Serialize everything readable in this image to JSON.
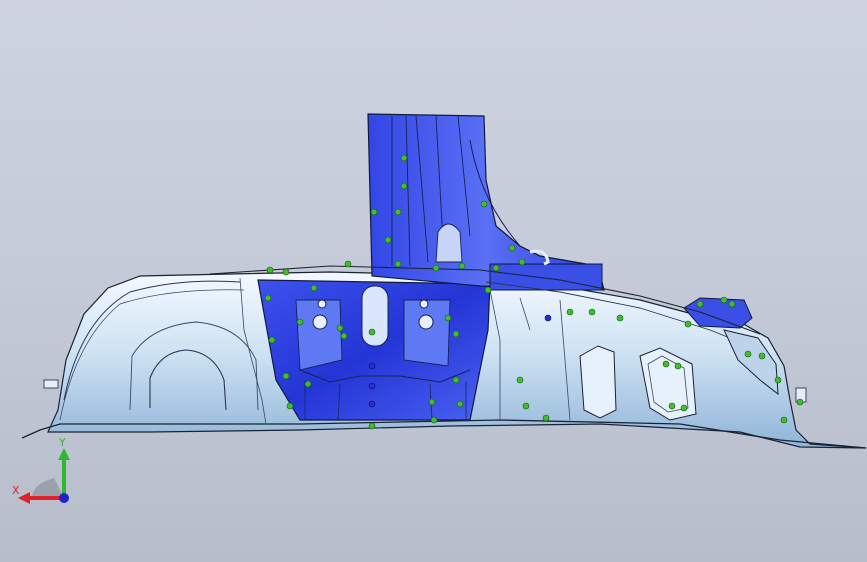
{
  "viewport": {
    "background_top": "#ced3e0",
    "background_bottom": "#b7bdcb"
  },
  "part": {
    "surface_color": "#cfe4f4",
    "highlight_color": "#2d3fe0",
    "edge_color": "#1a2233",
    "pin_color": "#3fbf2a"
  },
  "triad": {
    "x_label": "X",
    "y_label": "Y",
    "x_color": "#e0222a",
    "y_color": "#2fb82f",
    "z_color": "#2222cc"
  }
}
